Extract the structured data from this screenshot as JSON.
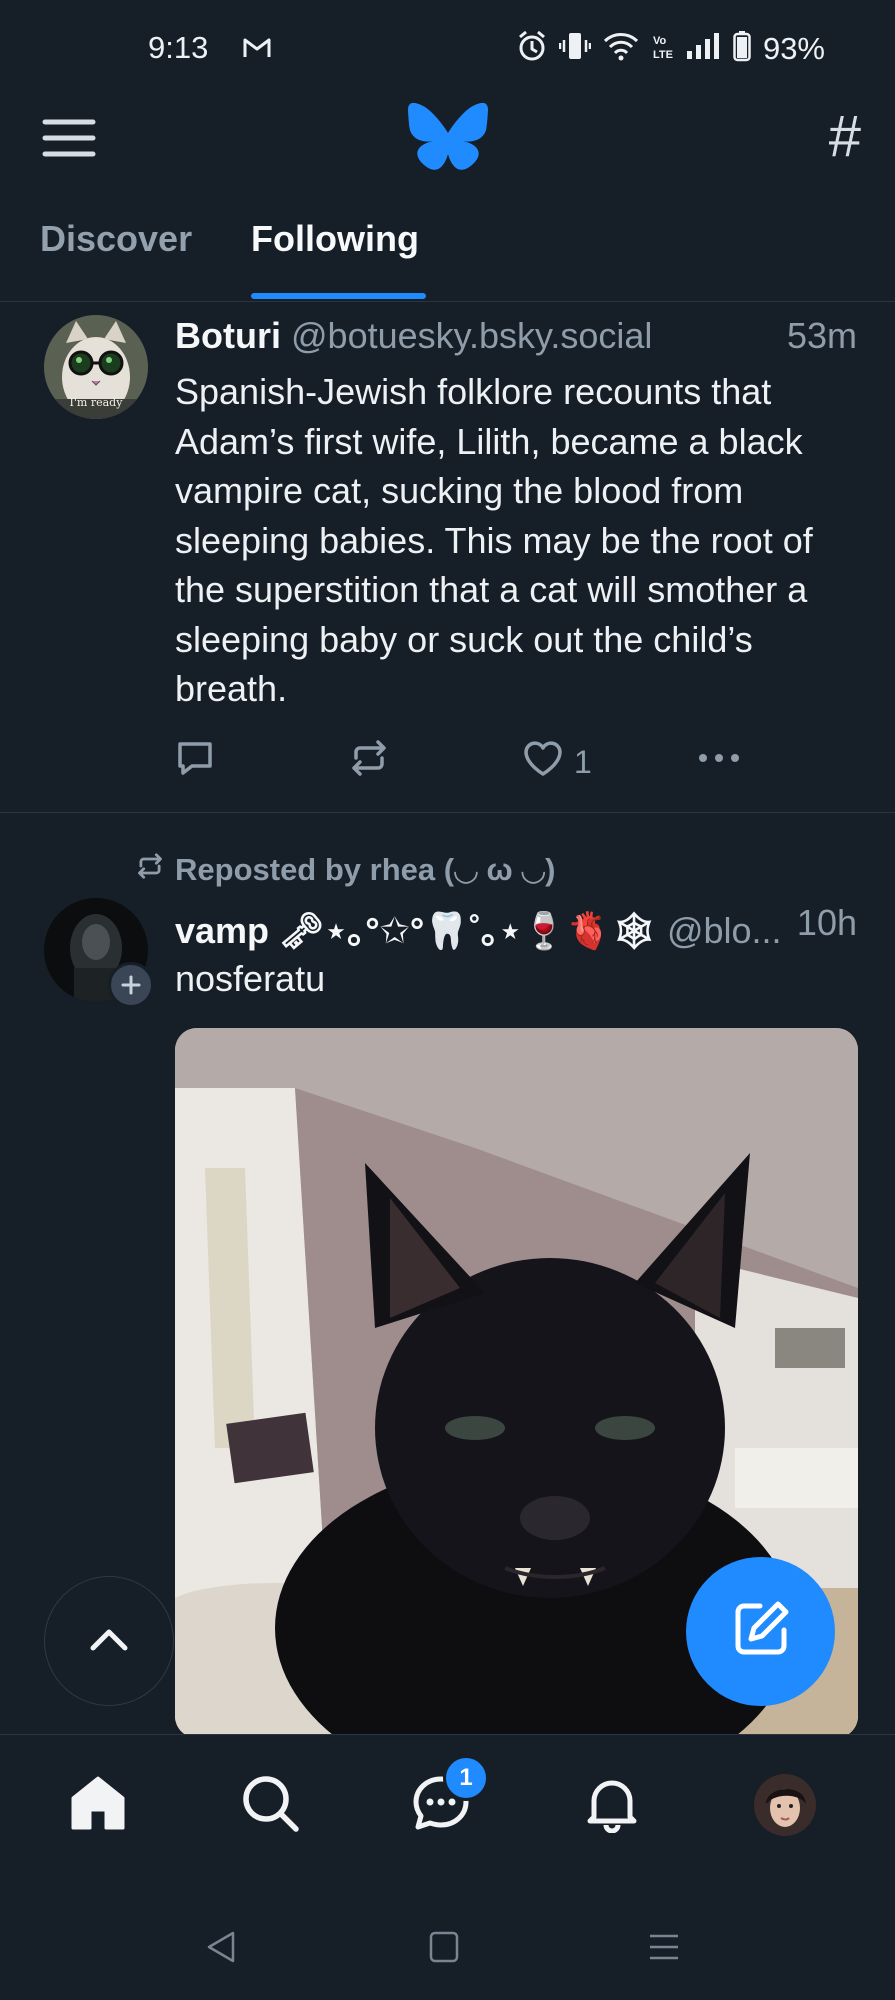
{
  "status_bar": {
    "time": "9:13",
    "battery": "93%",
    "icons": [
      "gmail-icon",
      "alarm-icon",
      "vibrate-icon",
      "wifi-icon",
      "volte-icon",
      "signal-icon",
      "battery-icon"
    ]
  },
  "header": {
    "logo": "bluesky-butterfly-icon",
    "tabs": [
      {
        "label": "Discover",
        "active": false
      },
      {
        "label": "Following",
        "active": true
      }
    ],
    "hashtag_label": "#"
  },
  "feed": [
    {
      "name": "Boturi",
      "handle": "@botuesky.bsky.social",
      "time": "53m",
      "avatar_caption": "I'm ready",
      "text": "Spanish-Jewish folklore recounts that Adam’s first wife, Lilith, became a black vampire cat, sucking the blood from sleeping babies. This may be the root of the superstition that a cat will smother a sleeping baby or suck out the child’s breath.",
      "likes": "1"
    },
    {
      "repost_by": "Reposted by rhea (◡ ω ◡)",
      "name": "vamp 🗝⋆｡°✩°🦷˚｡⋆🍷🫀🕸",
      "handle": "@blo...",
      "time": "10h",
      "text": "nosferatu",
      "image_alt": "black cat baring fangs"
    }
  ],
  "bottom_nav": {
    "items": [
      "home-icon",
      "search-icon",
      "chat-icon",
      "bell-icon",
      "profile-avatar"
    ],
    "chat_badge": "1"
  },
  "colors": {
    "background": "#161e27",
    "accent": "#208bfe",
    "muted": "#8f9dab"
  }
}
